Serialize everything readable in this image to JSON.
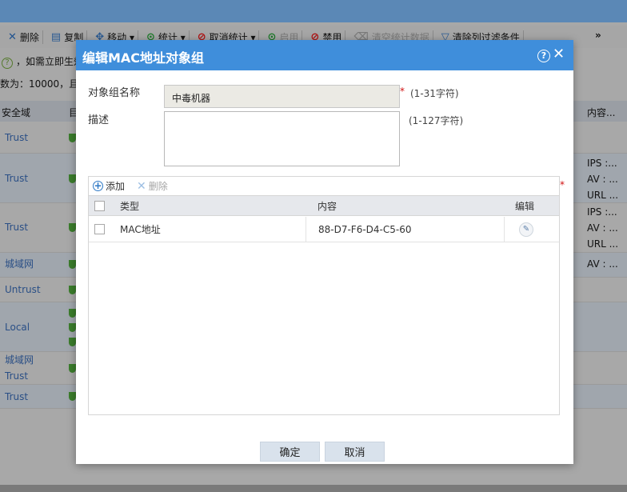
{
  "background": {
    "toolbar": [
      {
        "icon": "close-icon",
        "label": "删除",
        "dim": false
      },
      {
        "icon": "copy-icon",
        "label": "复制",
        "dim": false
      },
      {
        "icon": "move-icon",
        "label": "移动 ▾",
        "dim": false
      },
      {
        "icon": "play-icon",
        "label": "统计 ▾",
        "dim": false
      },
      {
        "icon": "forbid-icon",
        "label": "取消统计 ▾",
        "dim": false
      },
      {
        "icon": "play-icon",
        "label": "启用",
        "dim": true
      },
      {
        "icon": "forbid-icon",
        "label": "禁用",
        "dim": false
      },
      {
        "icon": "clear-icon",
        "label": "清空统计数据",
        "dim": true
      },
      {
        "icon": "filter-icon",
        "label": "清除列过滤条件",
        "dim": false
      }
    ],
    "more": "»",
    "hint": "，如需立即生效",
    "count": "数为：10000，且",
    "table_headers": [
      "安全域",
      "目",
      "内容..."
    ],
    "rows": [
      {
        "zone": "Trust",
        "right": ""
      },
      {
        "zone": "Trust",
        "right": "IPS :...\nAV : ...\nURL ..."
      },
      {
        "zone": "Trust",
        "right": "IPS :...\nAV : ...\nURL ..."
      },
      {
        "zone": "城域网",
        "right": "AV : ..."
      },
      {
        "zone": "Untrust",
        "right": ""
      },
      {
        "zone": "Local",
        "right": ""
      },
      {
        "zone": "城域网\nTrust",
        "right": ""
      },
      {
        "zone": "Trust",
        "right": ""
      }
    ]
  },
  "dialog": {
    "title": "编辑MAC地址对象组",
    "help_symbol": "?",
    "close_symbol": "✕",
    "name_label": "对象组名称",
    "name_value": "中毒机器",
    "name_required": "*",
    "name_hint": "(1-31字符)",
    "desc_label": "描述",
    "desc_value": "",
    "desc_hint": "(1-127字符)",
    "grid_required": "*",
    "grid": {
      "add_label": "添加",
      "delete_label": "删除",
      "columns": [
        "类型",
        "内容",
        "编辑"
      ],
      "rows": [
        {
          "type": "MAC地址",
          "content": "88-D7-F6-D4-C5-60"
        }
      ]
    },
    "ok_label": "确定",
    "cancel_label": "取消"
  }
}
